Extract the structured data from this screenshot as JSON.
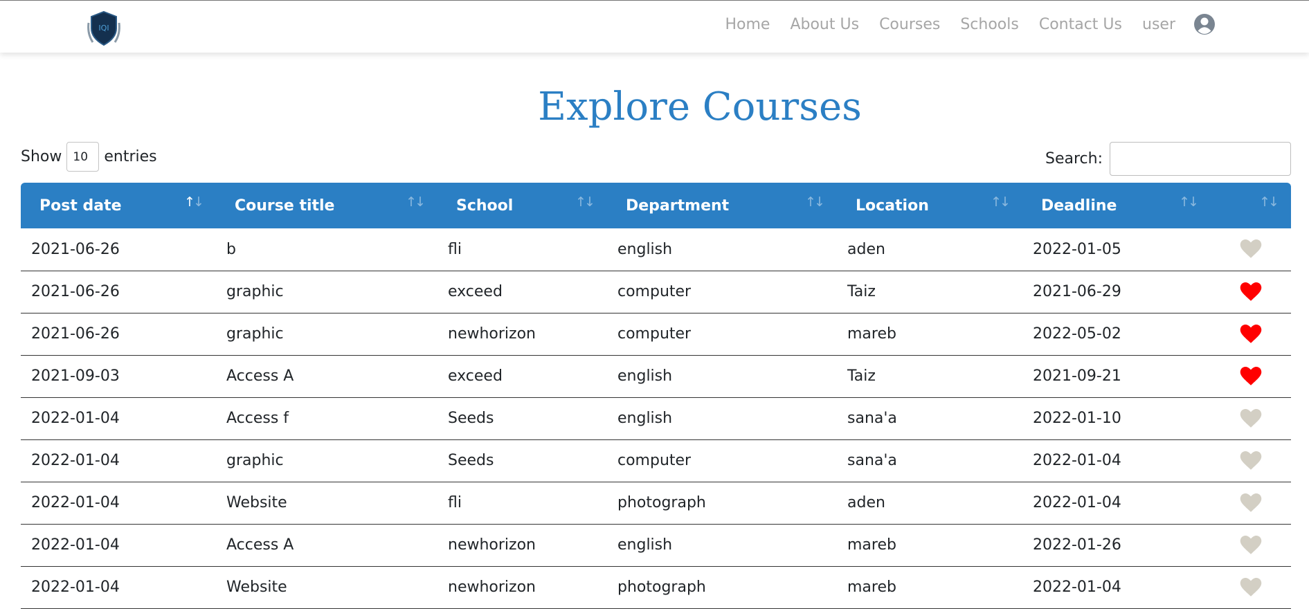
{
  "nav": {
    "links": [
      "Home",
      "About Us",
      "Courses",
      "Schools",
      "Contact Us",
      "user"
    ]
  },
  "page": {
    "title": "Explore Courses"
  },
  "controls": {
    "show_label": "Show",
    "entries_value": "10",
    "entries_label": "entries",
    "search_label": "Search:",
    "search_value": ""
  },
  "table": {
    "headers": [
      "Post date",
      "Course title",
      "School",
      "Department",
      "Location",
      "Deadline",
      ""
    ],
    "rows": [
      {
        "post_date": "2021-06-26",
        "title": "b",
        "school": "fli",
        "department": "english",
        "location": "aden",
        "deadline": "2022-01-05",
        "favorite": false
      },
      {
        "post_date": "2021-06-26",
        "title": "graphic",
        "school": "exceed",
        "department": "computer",
        "location": "Taiz",
        "deadline": "2021-06-29",
        "favorite": true
      },
      {
        "post_date": "2021-06-26",
        "title": "graphic",
        "school": "newhorizon",
        "department": "computer",
        "location": "mareb",
        "deadline": "2022-05-02",
        "favorite": true
      },
      {
        "post_date": "2021-09-03",
        "title": "Access A",
        "school": "exceed",
        "department": "english",
        "location": "Taiz",
        "deadline": "2021-09-21",
        "favorite": true
      },
      {
        "post_date": "2022-01-04",
        "title": "Access f",
        "school": "Seeds",
        "department": "english",
        "location": "sana'a",
        "deadline": "2022-01-10",
        "favorite": false
      },
      {
        "post_date": "2022-01-04",
        "title": "graphic",
        "school": "Seeds",
        "department": "computer",
        "location": "sana'a",
        "deadline": "2022-01-04",
        "favorite": false
      },
      {
        "post_date": "2022-01-04",
        "title": "Website",
        "school": "fli",
        "department": "photograph",
        "location": "aden",
        "deadline": "2022-01-04",
        "favorite": false
      },
      {
        "post_date": "2022-01-04",
        "title": "Access A",
        "school": "newhorizon",
        "department": "english",
        "location": "mareb",
        "deadline": "2022-01-26",
        "favorite": false
      },
      {
        "post_date": "2022-01-04",
        "title": "Website",
        "school": "newhorizon",
        "department": "photograph",
        "location": "mareb",
        "deadline": "2022-01-04",
        "favorite": false
      }
    ]
  },
  "colors": {
    "accent": "#2b7fc4",
    "nav_text": "#a6a6a6",
    "heart_active": "#ff0000",
    "heart_inactive": "#d3cfc4"
  },
  "icons": {
    "logo": "shield-logo-icon",
    "user": "user-circle-icon",
    "sort": "sort-arrows-icon",
    "favorite": "heart-icon"
  }
}
